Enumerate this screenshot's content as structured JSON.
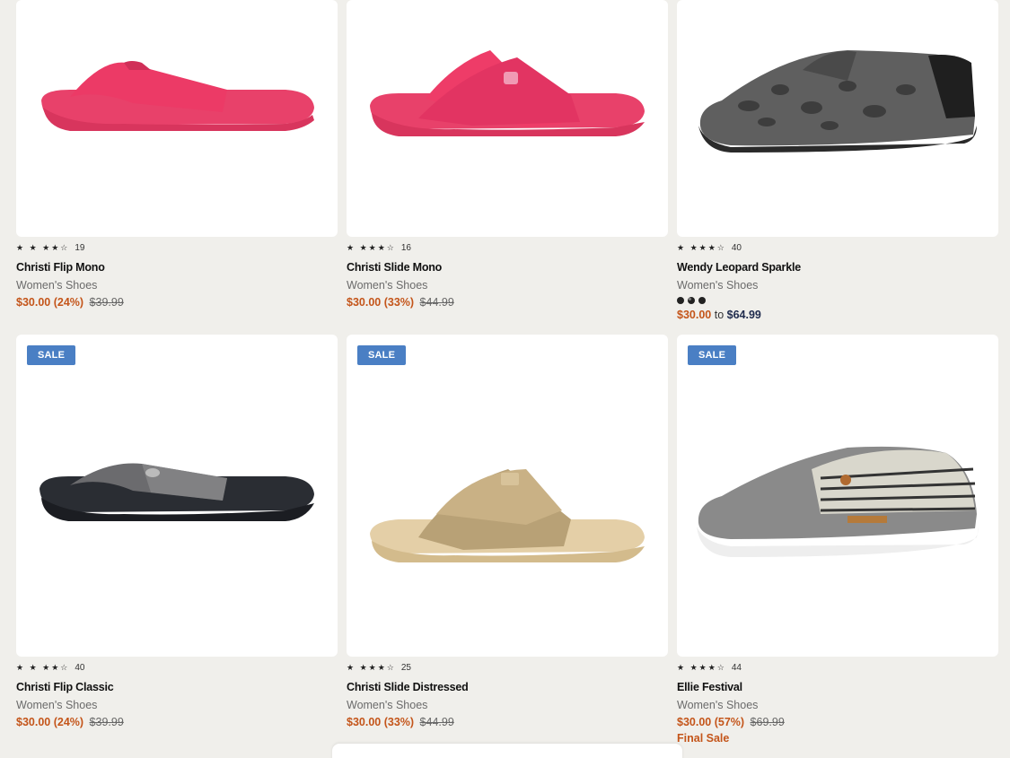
{
  "colors": {
    "background": "#f0efeb",
    "sale_badge": "#4a7fc4",
    "sale_price": "#c4551a",
    "high_price": "#1f2b4d"
  },
  "products": [
    {
      "name": "Christi Flip Mono",
      "category": "Women's Shoes",
      "rating_count": "19",
      "stars": "★ ★ ★★☆",
      "price": "$30.00 (24%)",
      "original_price": "$39.99",
      "sale_badge": "",
      "image": "pink-flip-flop"
    },
    {
      "name": "Christi Slide Mono",
      "category": "Women's Shoes",
      "rating_count": "16",
      "stars": "★ ★★★☆",
      "price": "$30.00 (33%)",
      "original_price": "$44.99",
      "sale_badge": "",
      "image": "pink-slide"
    },
    {
      "name": "Wendy Leopard Sparkle",
      "category": "Women's Shoes",
      "rating_count": "40",
      "stars": "★ ★★★☆",
      "price_low": "$30.00",
      "price_to": "to",
      "price_high": "$64.99",
      "sale_badge": "",
      "image": "leopard-loafer"
    },
    {
      "name": "Christi Flip Classic",
      "category": "Women's Shoes",
      "rating_count": "40",
      "stars": "★ ★ ★★☆",
      "price": "$30.00 (24%)",
      "original_price": "$39.99",
      "sale_badge": "SALE",
      "image": "black-flip-flop"
    },
    {
      "name": "Christi Slide Distressed",
      "category": "Women's Shoes",
      "rating_count": "25",
      "stars": "★ ★★★☆",
      "price": "$30.00 (33%)",
      "original_price": "$44.99",
      "sale_badge": "SALE",
      "image": "tan-slide"
    },
    {
      "name": "Ellie Festival",
      "category": "Women's Shoes",
      "rating_count": "44",
      "stars": "★ ★★★☆",
      "price": "$30.00 (57%)",
      "original_price": "$69.99",
      "sale_badge": "SALE",
      "final_sale": "Final Sale",
      "image": "striped-loafer"
    }
  ]
}
